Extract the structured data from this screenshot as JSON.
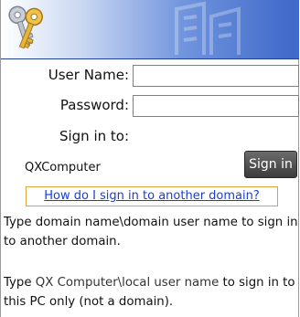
{
  "form": {
    "username_label": "User Name:",
    "username_value": "",
    "password_label": "Password:",
    "password_value": "",
    "signin_to_label": "Sign in to:",
    "computer_name": "QXComputer",
    "signin_button": "Sign in",
    "help_link": "How do I sign in to another domain?"
  },
  "help": {
    "line1": "Type domain name\\domain user name to sign in to another domain.",
    "line2_prefix": "Type ",
    "line2_code": "QX Computer\\local user name",
    "line2_suffix": " to sign in to this PC only (not a domain)."
  },
  "colors": {
    "link": "#1a3fd1",
    "focus_border": "#e0a33a",
    "button_bg": "#4a4a4a"
  },
  "icons": {
    "banner_icon": "keys-icon",
    "banner_watermark": "building-watermark"
  }
}
